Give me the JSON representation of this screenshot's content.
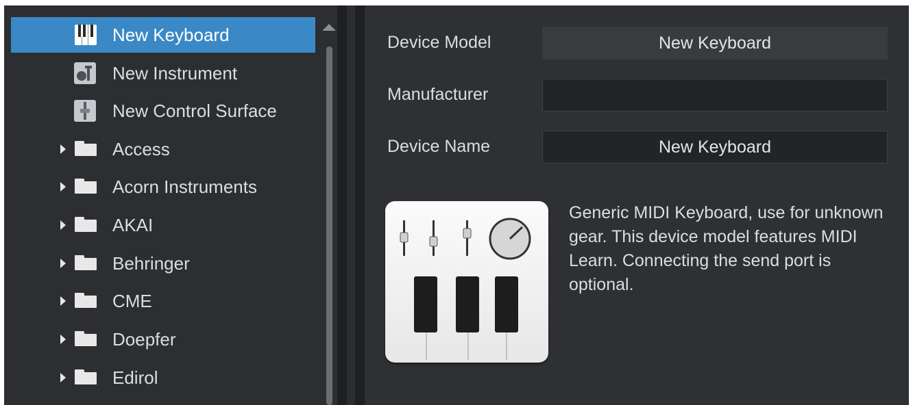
{
  "tree": {
    "items": [
      {
        "label": "New Keyboard",
        "icon": "keyboard-icon",
        "selected": true
      },
      {
        "label": "New Instrument",
        "icon": "instrument-icon"
      },
      {
        "label": "New Control Surface",
        "icon": "control-surface-icon"
      },
      {
        "label": "Access",
        "icon": "folder-icon"
      },
      {
        "label": "Acorn Instruments",
        "icon": "folder-icon"
      },
      {
        "label": "AKAI",
        "icon": "folder-icon"
      },
      {
        "label": "Behringer",
        "icon": "folder-icon"
      },
      {
        "label": "CME",
        "icon": "folder-icon"
      },
      {
        "label": "Doepfer",
        "icon": "folder-icon"
      },
      {
        "label": "Edirol",
        "icon": "folder-icon"
      }
    ]
  },
  "props": {
    "device_model_label": "Device Model",
    "device_model_value": "New Keyboard",
    "manufacturer_label": "Manufacturer",
    "manufacturer_value": "",
    "device_name_label": "Device Name",
    "device_name_value": "New Keyboard",
    "description": "Generic MIDI Keyboard, use for unknown gear. This device model features MIDI Learn. Connecting the send port is optional.",
    "device_icon": "midi-keyboard-icon"
  },
  "colors": {
    "selection": "#3a88c6",
    "panel_background": "#2c2e31",
    "text": "#dcdde0"
  }
}
